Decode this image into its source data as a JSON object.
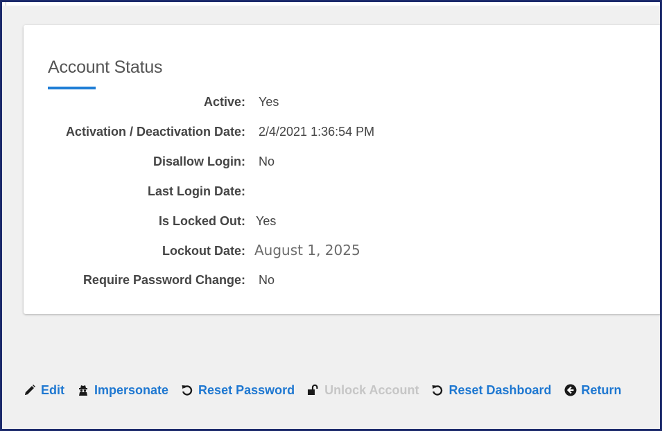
{
  "account_status": {
    "title": "Account Status",
    "fields": [
      {
        "label": "Active:",
        "value": "Yes"
      },
      {
        "label": "Activation / Deactivation Date:",
        "value": "2/4/2021 1:36:54 PM"
      },
      {
        "label": "Disallow Login:",
        "value": "No"
      },
      {
        "label": "Last Login Date:",
        "value": ""
      },
      {
        "label": "Is Locked Out:",
        "value": "Yes"
      },
      {
        "label": "Lockout Date:",
        "value": "August 1, 2025"
      },
      {
        "label": "Require Password Change:",
        "value": "No"
      }
    ]
  },
  "actions": [
    {
      "label": "Edit",
      "icon": "pencil-icon",
      "enabled": true
    },
    {
      "label": "Impersonate",
      "icon": "spy-icon",
      "enabled": true
    },
    {
      "label": "Reset Password",
      "icon": "reset-icon",
      "enabled": true
    },
    {
      "label": "Unlock Account",
      "icon": "unlock-icon",
      "enabled": false
    },
    {
      "label": "Reset Dashboard",
      "icon": "reset-icon",
      "enabled": true
    },
    {
      "label": "Return",
      "icon": "circle-arrow-left-icon",
      "enabled": true
    }
  ],
  "colors": {
    "accent": "#1f7ed6",
    "link": "#1f78d1",
    "disabled": "#c6c6c6",
    "frame_border": "#1c2a6b",
    "background": "#f0f0f0"
  }
}
